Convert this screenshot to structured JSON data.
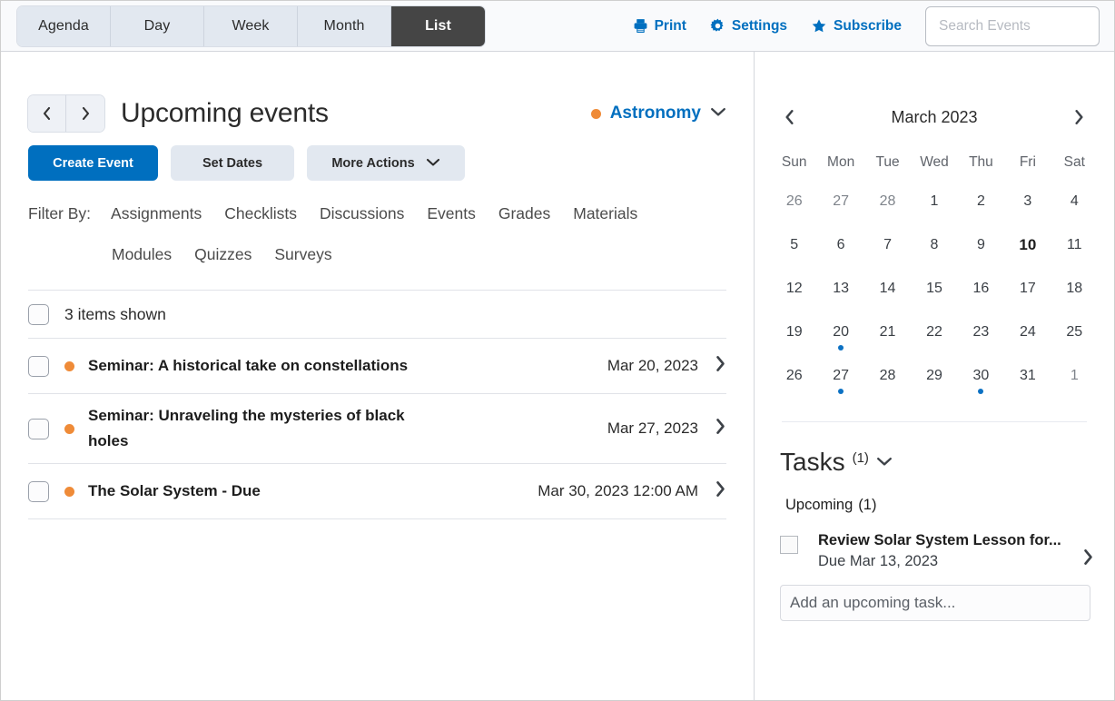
{
  "toolbar": {
    "view_tabs": [
      {
        "label": "Agenda",
        "active": false
      },
      {
        "label": "Day",
        "active": false
      },
      {
        "label": "Week",
        "active": false
      },
      {
        "label": "Month",
        "active": false
      },
      {
        "label": "List",
        "active": true
      }
    ],
    "print_label": "Print",
    "settings_label": "Settings",
    "subscribe_label": "Subscribe",
    "search_placeholder": "Search Events",
    "search_value": ""
  },
  "main": {
    "title": "Upcoming events",
    "course": {
      "name": "Astronomy",
      "color": "#ef8b38"
    },
    "buttons": {
      "create_event": "Create Event",
      "set_dates": "Set Dates",
      "more_actions": "More Actions"
    },
    "filter": {
      "label": "Filter By:",
      "items": [
        "Assignments",
        "Checklists",
        "Discussions",
        "Events",
        "Grades",
        "Materials",
        "Modules",
        "Quizzes",
        "Surveys"
      ]
    },
    "items_shown": "3 items shown",
    "events": [
      {
        "title": "Seminar: A historical take on constellations",
        "date": "Mar 20, 2023",
        "dot": "#ef8b38"
      },
      {
        "title": "Seminar: Unraveling the mysteries of black holes",
        "date": "Mar 27, 2023",
        "dot": "#ef8b38"
      },
      {
        "title": "The Solar System - Due",
        "date": "Mar 30, 2023 12:00 AM",
        "dot": "#ef8b38"
      }
    ]
  },
  "calendar": {
    "month_label": "March 2023",
    "weekdays": [
      "Sun",
      "Mon",
      "Tue",
      "Wed",
      "Thu",
      "Fri",
      "Sat"
    ],
    "weeks": [
      [
        {
          "d": "26",
          "muted": true
        },
        {
          "d": "27",
          "muted": true
        },
        {
          "d": "28",
          "muted": true
        },
        {
          "d": "1"
        },
        {
          "d": "2"
        },
        {
          "d": "3"
        },
        {
          "d": "4"
        }
      ],
      [
        {
          "d": "5"
        },
        {
          "d": "6"
        },
        {
          "d": "7"
        },
        {
          "d": "8"
        },
        {
          "d": "9"
        },
        {
          "d": "10",
          "today": true
        },
        {
          "d": "11"
        }
      ],
      [
        {
          "d": "12"
        },
        {
          "d": "13"
        },
        {
          "d": "14"
        },
        {
          "d": "15"
        },
        {
          "d": "16"
        },
        {
          "d": "17"
        },
        {
          "d": "18"
        }
      ],
      [
        {
          "d": "19"
        },
        {
          "d": "20",
          "event": true
        },
        {
          "d": "21"
        },
        {
          "d": "22"
        },
        {
          "d": "23"
        },
        {
          "d": "24"
        },
        {
          "d": "25"
        }
      ],
      [
        {
          "d": "26"
        },
        {
          "d": "27",
          "event": true
        },
        {
          "d": "28"
        },
        {
          "d": "29"
        },
        {
          "d": "30",
          "event": true
        },
        {
          "d": "31"
        },
        {
          "d": "1",
          "muted": true
        }
      ]
    ],
    "event_dot_color": "#0c71c3"
  },
  "tasks": {
    "title": "Tasks",
    "count": "(1)",
    "section_label": "Upcoming",
    "section_count": "(1)",
    "items": [
      {
        "title": "Review Solar System Lesson for...",
        "due": "Due Mar 13, 2023"
      }
    ],
    "add_placeholder": "Add an upcoming task...",
    "add_value": ""
  }
}
